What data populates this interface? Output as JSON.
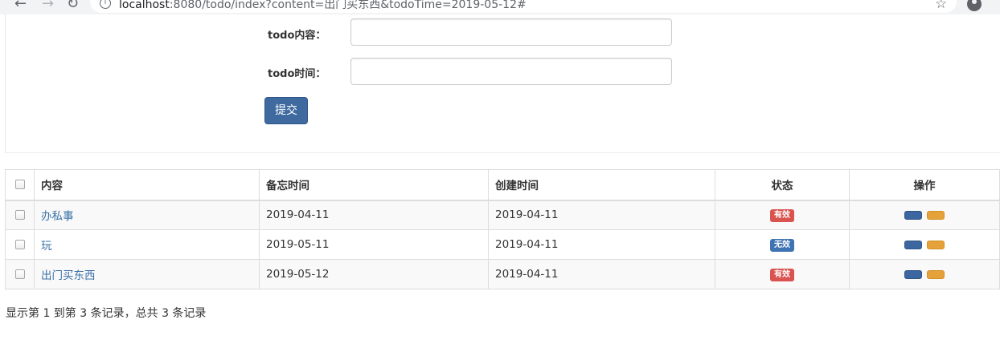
{
  "browser": {
    "url_host": "localhost",
    "url_rest": ":8080/todo/index?content=出门买东西&todoTime=2019-05-12#",
    "back_icon": "arrow-left-icon",
    "forward_icon": "arrow-right-icon",
    "reload_icon": "reload-icon",
    "info_icon": "info-icon",
    "star_icon": "star-icon",
    "account_icon": "account-icon"
  },
  "form": {
    "content_label": "todo内容：",
    "content_value": "",
    "time_label": "todo时间：",
    "time_value": "",
    "submit_label": "提交"
  },
  "table": {
    "headers": {
      "content": "内容",
      "memo_time": "备忘时间",
      "created_time": "创建时间",
      "status": "状态",
      "operations": "操作"
    },
    "rows": [
      {
        "content": "办私事",
        "memo_time": "2019-04-11",
        "created_time": "2019-04-11",
        "status": "有效",
        "status_color": "#d9534f"
      },
      {
        "content": "玩",
        "memo_time": "2019-05-11",
        "created_time": "2019-04-11",
        "status": "无效",
        "status_color": "#3f74b4"
      },
      {
        "content": "出门买东西",
        "memo_time": "2019-05-12",
        "created_time": "2019-04-11",
        "status": "有效",
        "status_color": "#d9534f"
      }
    ]
  },
  "pagination": {
    "summary": "显示第 1 到第 3 条记录，总共 3 条记录"
  },
  "colors": {
    "primary": "#3f6aa0",
    "warning": "#e5a23b",
    "danger": "#d9534f",
    "link": "#3a71a8"
  }
}
